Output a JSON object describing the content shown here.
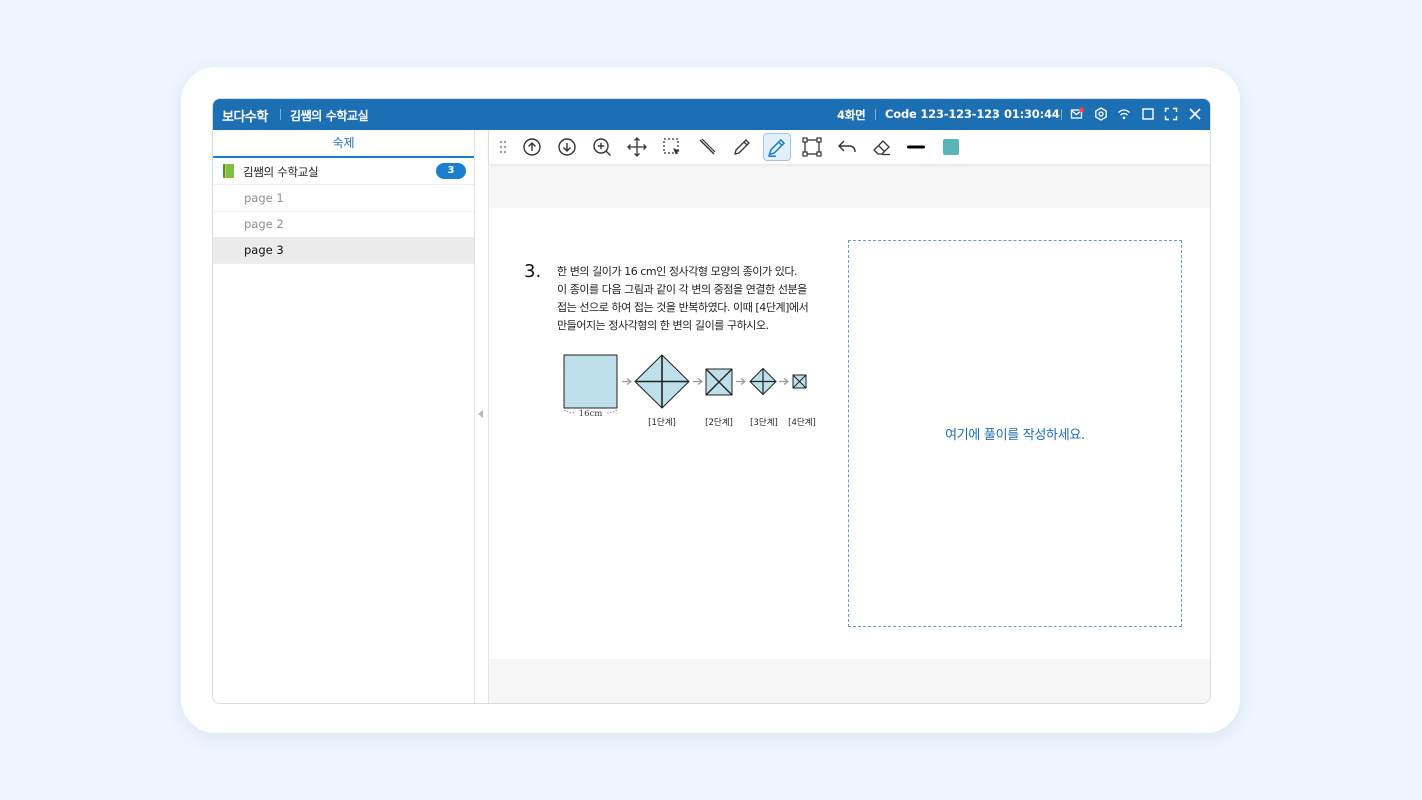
{
  "titlebar": {
    "brand": "보다수학",
    "class_name": "김쌤의 수학교실",
    "screen": "4화면",
    "code": "Code 123-123-123",
    "timer": "01:30:44",
    "icons": [
      "mail-icon",
      "settings-icon",
      "wifi-icon",
      "window-icon",
      "fullscreen-icon",
      "close-icon"
    ],
    "color": "#1c6fb3"
  },
  "sidebar": {
    "tab": "숙제",
    "folder": {
      "label": "김쌤의 수학교실",
      "count": "3"
    },
    "pages": [
      {
        "label": "page 1",
        "active": false
      },
      {
        "label": "page 2",
        "active": false
      },
      {
        "label": "page 3",
        "active": true
      }
    ]
  },
  "toolbar": {
    "tools": [
      "scroll-up",
      "scroll-down",
      "zoom-in",
      "move",
      "select",
      "line",
      "pencil",
      "highlighter",
      "transform",
      "undo",
      "eraser",
      "stroke-width",
      "color"
    ],
    "active_tool": "highlighter",
    "pen_color": "#5ab3b8"
  },
  "problem": {
    "number": "3.",
    "lines": [
      "한 변의 길이가 16 cm인 정사각형 모양의 종이가 있다.",
      "이 종이를 다음 그림과 같이 각 변의 중점을 연결한 선분을",
      "접는 선으로 하여 접는 것을 반복하였다. 이때 [4단계]에서",
      "만들어지는 정사각형의 한 변의 길이를 구하시오."
    ],
    "figure": {
      "size_label": "16cm",
      "steps": [
        "[1단계]",
        "[2단계]",
        "[3단계]",
        "[4단계]"
      ],
      "fill": "#bde0eb"
    }
  },
  "answer": {
    "hint": "여기에 풀이를 작성하세요."
  }
}
